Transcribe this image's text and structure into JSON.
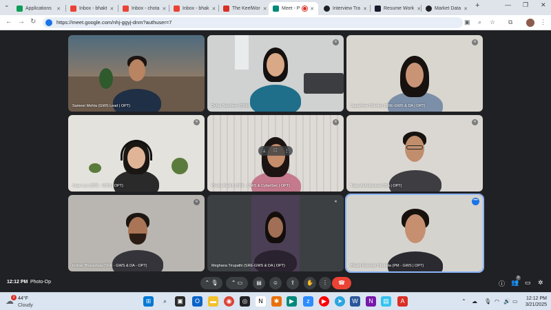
{
  "browser": {
    "tabs": [
      {
        "label": "Applications",
        "color": "#0f9d58"
      },
      {
        "label": "Inbox - bhakt",
        "color": "#ea4335"
      },
      {
        "label": "Inbox - chota",
        "color": "#ea4335"
      },
      {
        "label": "Inbox - bhak",
        "color": "#ea4335"
      },
      {
        "label": "The KeelWor",
        "color": "#d93025"
      },
      {
        "label": "Meet - P",
        "color": "#00897b"
      },
      {
        "label": "Interview Tra",
        "color": "#202124"
      },
      {
        "label": "Resume Work",
        "color": "#1a1a2e"
      },
      {
        "label": "Market Data",
        "color": "#202124"
      }
    ],
    "url": "https://meet.google.com/nhj-ggyj-dnm?authuser=7"
  },
  "participants": [
    {
      "name": "Sameer Mehta (GWS Lead | OPT)",
      "bg": "#6b5a4a",
      "shirt": "#1f2f45",
      "skin": "#b88462",
      "hair": "#1c1410"
    },
    {
      "name": "Dyhia Sunshine (SRE)",
      "bg": "#cfd2d0",
      "shirt": "#1f6f8b",
      "skin": "#d9a887",
      "hair": "#141110"
    },
    {
      "name": "Jayashree Chenley (SRE-GWS & DA | OPT)",
      "bg": "#d9d6cf",
      "shirt": "#7c8fa8",
      "skin": "#c99476",
      "hair": "#171210"
    },
    {
      "name": "Xuan Luo (SRE - GWS | OPT)",
      "bg": "#e4e2dc",
      "shirt": "#2a2a2a",
      "skin": "#e0b597",
      "hair": "#1a1613"
    },
    {
      "name": "Prisha Parikh (SRE - GWS & CyberSec | OPT)",
      "bg": "#d7d3cf",
      "shirt": "#c47a8c",
      "skin": "#c58d6b",
      "hair": "#1b1412"
    },
    {
      "name": "Tejas Ashokprasad (DA | OPT)",
      "bg": "#dad7d2",
      "shirt": "#3d3d42",
      "skin": "#c08e6d",
      "hair": "#161210"
    },
    {
      "name": "Rohan Bharadwaj (SRE - GWS & DA - OPT)",
      "bg": "#b9b6b1",
      "shirt": "#34343a",
      "skin": "#a97556",
      "hair": "#1c1510"
    },
    {
      "name": "Meghana Tirupathi (SRE-GWS & DA | OPT)",
      "bg": "#4a3f55",
      "shirt": "#2b2230",
      "skin": "#a06f55",
      "hair": "#130e0c"
    },
    {
      "name": "Bhakti Ramesh Chotalia (PM - GWS | OPT)",
      "bg": "#d5d3ce",
      "shirt": "#2a2a30",
      "skin": "#c68f70",
      "hair": "#17110e"
    }
  ],
  "meeting": {
    "time": "12:12 PM",
    "code": "Photo-Op",
    "people_count": "9"
  },
  "taskbar": {
    "weather_temp": "44°F",
    "weather_cond": "Cloudy",
    "weather_badge": "2",
    "clock_time": "12:12 PM",
    "clock_date": "3/21/2025"
  }
}
